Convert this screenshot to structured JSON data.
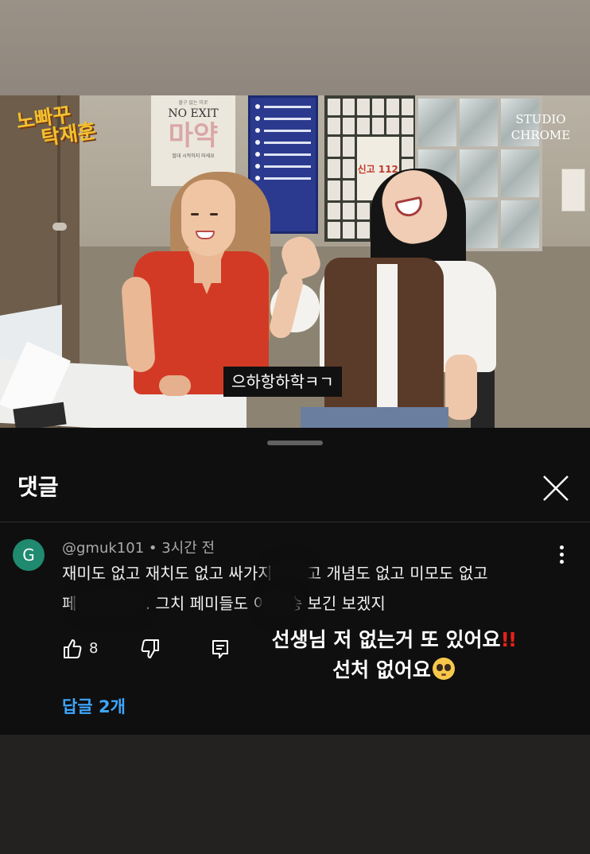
{
  "video": {
    "logo_line1": "노빠꾸",
    "logo_line2": "탁재훈",
    "poster_small": "출구 없는 미로",
    "poster_title": "NO EXIT",
    "poster_big": "마약",
    "poster_sub": "절대 시작하지 마세요",
    "wanted_badge": "신고 112",
    "studio_line1": "STUDIO",
    "studio_line2": "CHROME",
    "subtitle": "으하항하학ㅋㄱ"
  },
  "comments": {
    "title": "댓글",
    "close_icon": "close-icon",
    "comment": {
      "avatar_letter": "G",
      "avatar_color": "#1f8a70",
      "author": "@gmuk101",
      "time": "3시간 전",
      "line1": "재미도 없고 재치도 없고 싸가지도 없고 개념도 없고 미모도 없고",
      "line2": "페미들을 왜.. 그치 페미들도 이 방송 보긴 보겠지",
      "like_count": "8"
    },
    "replies_label": "답글 2개",
    "reply_accent": "#3ea6ff"
  },
  "overlay": {
    "line1": "선생님 저 없는거 또 있어요",
    "line1_mark": "!!",
    "line2": "선처 없어요"
  }
}
